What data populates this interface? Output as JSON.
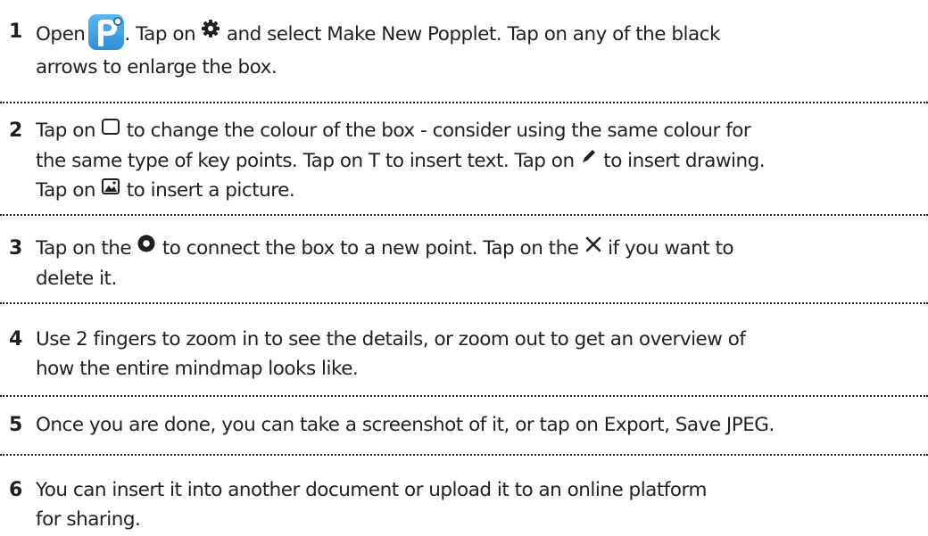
{
  "steps": [
    {
      "number": "1",
      "line1_a": "Open",
      "line1_b": ". Tap on",
      "line1_c": "and select Make New Popplet. Tap on any of the black",
      "line2": "arrows to enlarge the box.",
      "icons": [
        "popplet-app-icon",
        "gear-icon"
      ]
    },
    {
      "number": "2",
      "line1_a": "Tap on",
      "line1_b": "to change the colour of the box - consider using the same colour for",
      "line2_a": "the same type of key points. Tap on T to insert text. Tap on",
      "line2_b": "to insert drawing.",
      "line3_a": "Tap on",
      "line3_b": "to insert a picture.",
      "icons": [
        "square-outline-icon",
        "pencil-icon",
        "picture-icon"
      ]
    },
    {
      "number": "3",
      "line1_a": "Tap on the",
      "line1_b": "to connect the box to a new point. Tap on the",
      "line1_c": "if you want to",
      "line2": "delete it.",
      "icons": [
        "circle-connect-icon",
        "close-x-icon"
      ]
    },
    {
      "number": "4",
      "line1": "Use 2 fingers to zoom in to see the details, or zoom out to get an overview of",
      "line2": "how the entire mindmap looks like."
    },
    {
      "number": "5",
      "line1": "Once you are done, you can take a screenshot of it, or tap on Export, Save JPEG."
    },
    {
      "number": "6",
      "line1": "You can insert it into another document or upload it to an online platform",
      "line2": "for sharing."
    }
  ],
  "colors": {
    "text": "#231f20",
    "app_icon_blue": "#3a9ee3"
  }
}
